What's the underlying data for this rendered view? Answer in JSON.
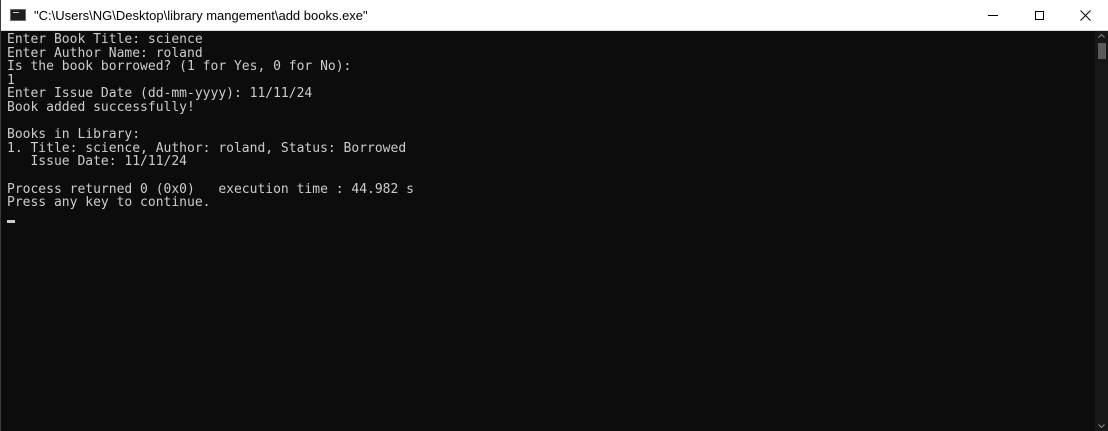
{
  "window": {
    "title": "\"C:\\Users\\NG\\Desktop\\library mangement\\add books.exe\""
  },
  "console": {
    "lines": [
      "Enter Book Title: science",
      "Enter Author Name: roland",
      "Is the book borrowed? (1 for Yes, 0 for No):",
      "1",
      "Enter Issue Date (dd-mm-yyyy): 11/11/24",
      "Book added successfully!",
      "",
      "Books in Library:",
      "1. Title: science, Author: roland, Status: Borrowed",
      "   Issue Date: 11/11/24",
      "",
      "Process returned 0 (0x0)   execution time : 44.982 s",
      "Press any key to continue."
    ]
  },
  "colors": {
    "console_background": "#0c0c0c",
    "console_text": "#cccccc",
    "titlebar": "#ffffff"
  },
  "icons": {
    "app": "console-app-icon",
    "minimize": "minimize-icon",
    "maximize": "maximize-icon",
    "close": "close-icon"
  }
}
